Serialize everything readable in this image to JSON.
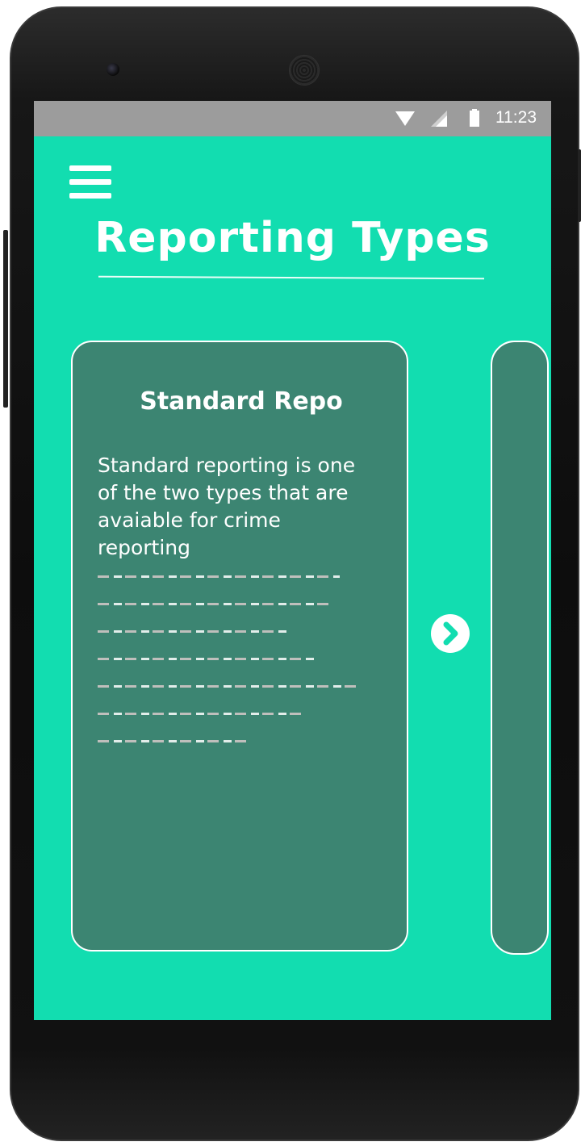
{
  "status_bar": {
    "time": "11:23",
    "icons": [
      "wifi-icon",
      "signal-icon",
      "battery-icon"
    ]
  },
  "header": {
    "menu_icon": "hamburger-menu-icon",
    "title": "Reporting Types"
  },
  "cards": [
    {
      "title": "Standard Repo",
      "description": "Standard reporting is one of the two types that are avaiable for crime reporting"
    }
  ],
  "next_button": {
    "icon": "chevron-right-icon"
  },
  "colors": {
    "screen_background": "#12ddb0",
    "card_background": "#3c8572",
    "status_bar": "#9c9c9c",
    "text": "#ffffff"
  }
}
